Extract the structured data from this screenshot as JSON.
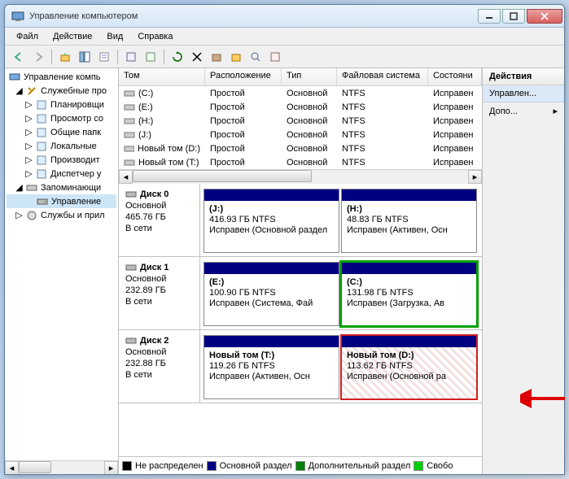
{
  "title": "Управление компьютером",
  "menus": [
    "Файл",
    "Действие",
    "Вид",
    "Справка"
  ],
  "tree": {
    "root": "Управление компь",
    "groups": [
      {
        "label": "Служебные про",
        "children": [
          "Планировщи",
          "Просмотр со",
          "Общие папк",
          "Локальные",
          "Производит",
          "Диспетчер у"
        ]
      },
      {
        "label": "Запоминающи",
        "children": [
          "Управление"
        ]
      },
      {
        "label": "Службы и прил",
        "children": []
      }
    ]
  },
  "volume_headers": {
    "tom": "Том",
    "rasp": "Расположение",
    "tip": "Тип",
    "fs": "Файловая система",
    "sost": "Состояни"
  },
  "volumes": [
    {
      "name": "(C:)",
      "rasp": "Простой",
      "tip": "Основной",
      "fs": "NTFS",
      "sost": "Исправен"
    },
    {
      "name": "(E:)",
      "rasp": "Простой",
      "tip": "Основной",
      "fs": "NTFS",
      "sost": "Исправен"
    },
    {
      "name": "(H:)",
      "rasp": "Простой",
      "tip": "Основной",
      "fs": "NTFS",
      "sost": "Исправен"
    },
    {
      "name": "(J:)",
      "rasp": "Простой",
      "tip": "Основной",
      "fs": "NTFS",
      "sost": "Исправен"
    },
    {
      "name": "Новый том (D:)",
      "rasp": "Простой",
      "tip": "Основной",
      "fs": "NTFS",
      "sost": "Исправен"
    },
    {
      "name": "Новый том (T:)",
      "rasp": "Простой",
      "tip": "Основной",
      "fs": "NTFS",
      "sost": "Исправен"
    }
  ],
  "disks": [
    {
      "title": "Диск 0",
      "type": "Основной",
      "size": "465.76 ГБ",
      "status": "В сети",
      "parts": [
        {
          "name": "(J:)",
          "size": "416.93 ГБ NTFS",
          "status": "Исправен (Основной раздел",
          "cls": ""
        },
        {
          "name": "(H:)",
          "size": "48.83 ГБ NTFS",
          "status": "Исправен (Активен, Осн",
          "cls": ""
        }
      ]
    },
    {
      "title": "Диск 1",
      "type": "Основной",
      "size": "232.89 ГБ",
      "status": "В сети",
      "parts": [
        {
          "name": "(E:)",
          "size": "100.90 ГБ NTFS",
          "status": "Исправен (Система, Фай",
          "cls": ""
        },
        {
          "name": "(C:)",
          "size": "131.98 ГБ NTFS",
          "status": "Исправен (Загрузка, Ав",
          "cls": "green-hl"
        }
      ]
    },
    {
      "title": "Диск 2",
      "type": "Основной",
      "size": "232.88 ГБ",
      "status": "В сети",
      "parts": [
        {
          "name": "Новый том  (T:)",
          "size": "119.26 ГБ NTFS",
          "status": "Исправен (Активен, Осн",
          "cls": ""
        },
        {
          "name": "Новый том  (D:)",
          "size": "113.62 ГБ NTFS",
          "status": "Исправен (Основной ра",
          "cls": "red-hl"
        }
      ]
    }
  ],
  "legend": {
    "unalloc": "Не распределен",
    "primary": "Основной раздел",
    "ext": "Дополнительный раздел",
    "free": "Свобо"
  },
  "actions": {
    "header": "Действия",
    "sub": "Управлен...",
    "more": "Допо..."
  }
}
